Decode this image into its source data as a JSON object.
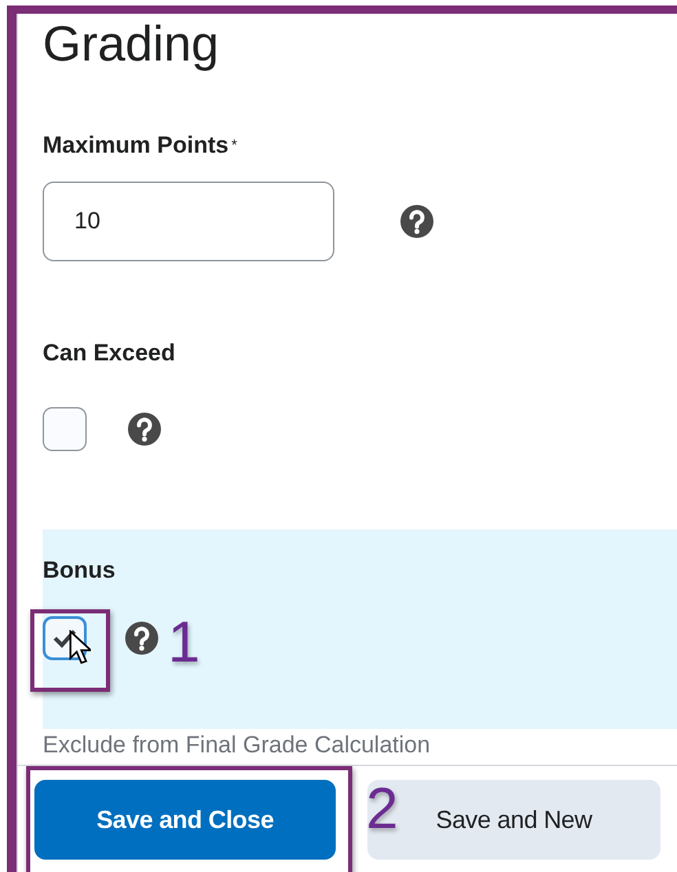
{
  "heading": "Grading",
  "max_points": {
    "label": "Maximum Points",
    "required_mark": "*",
    "value": "10"
  },
  "options": [
    {
      "label": "Can Exceed",
      "checked": false,
      "highlighted": false
    },
    {
      "label": "Bonus",
      "checked": true,
      "highlighted": true
    }
  ],
  "hidden_field_label": "Exclude from Final Grade Calculation",
  "buttons": [
    {
      "label": "Save and Close",
      "kind": "primary"
    },
    {
      "label": "Save and New",
      "kind": "secondary"
    }
  ],
  "callouts": [
    {
      "number": "1"
    },
    {
      "number": "2"
    }
  ]
}
